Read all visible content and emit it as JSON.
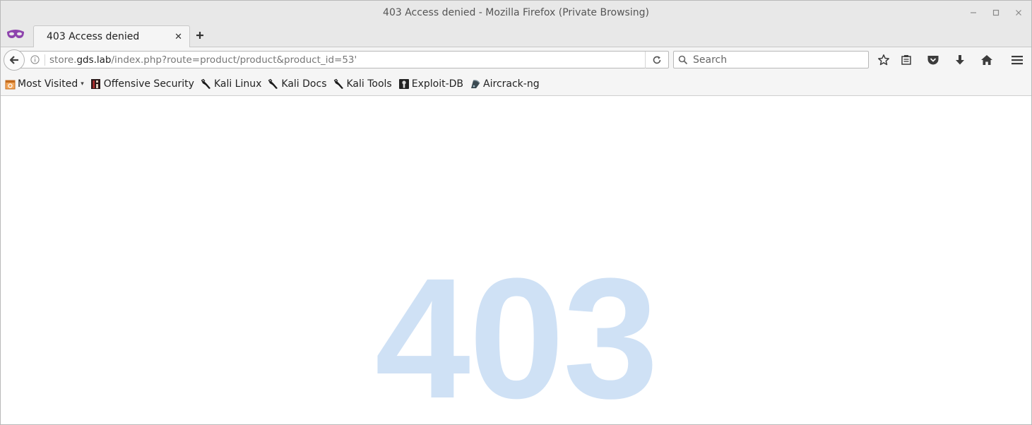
{
  "window": {
    "title": "403 Access denied - Mozilla Firefox (Private Browsing)",
    "controls": {
      "minimize_icon": "minimize-icon",
      "maximize_icon": "maximize-icon",
      "close_icon": "close-icon"
    }
  },
  "tabs": [
    {
      "label": "403 Access denied",
      "active": true
    }
  ],
  "navbar": {
    "url_host_prefix": "store.",
    "url_host_domain": "gds.lab",
    "url_path": "/index.php?route=product/product&product_id=53'",
    "search_placeholder": "Search"
  },
  "bookmarks": [
    {
      "label": "Most Visited",
      "icon": "most-visited-icon",
      "dropdown": "▾"
    },
    {
      "label": "Offensive Security",
      "icon": "offensive-security-icon"
    },
    {
      "label": "Kali Linux",
      "icon": "kali-dragon-icon"
    },
    {
      "label": "Kali Docs",
      "icon": "kali-dragon-icon"
    },
    {
      "label": "Kali Tools",
      "icon": "kali-dragon-icon"
    },
    {
      "label": "Exploit-DB",
      "icon": "exploit-db-icon"
    },
    {
      "label": "Aircrack-ng",
      "icon": "aircrack-icon"
    }
  ],
  "page": {
    "code": "403",
    "code_color": "#cfe1f5"
  },
  "colors": {
    "chrome_bg": "#e8e8e8",
    "toolbar_bg": "#f5f5f5",
    "private_mask": "#8e44ad"
  }
}
